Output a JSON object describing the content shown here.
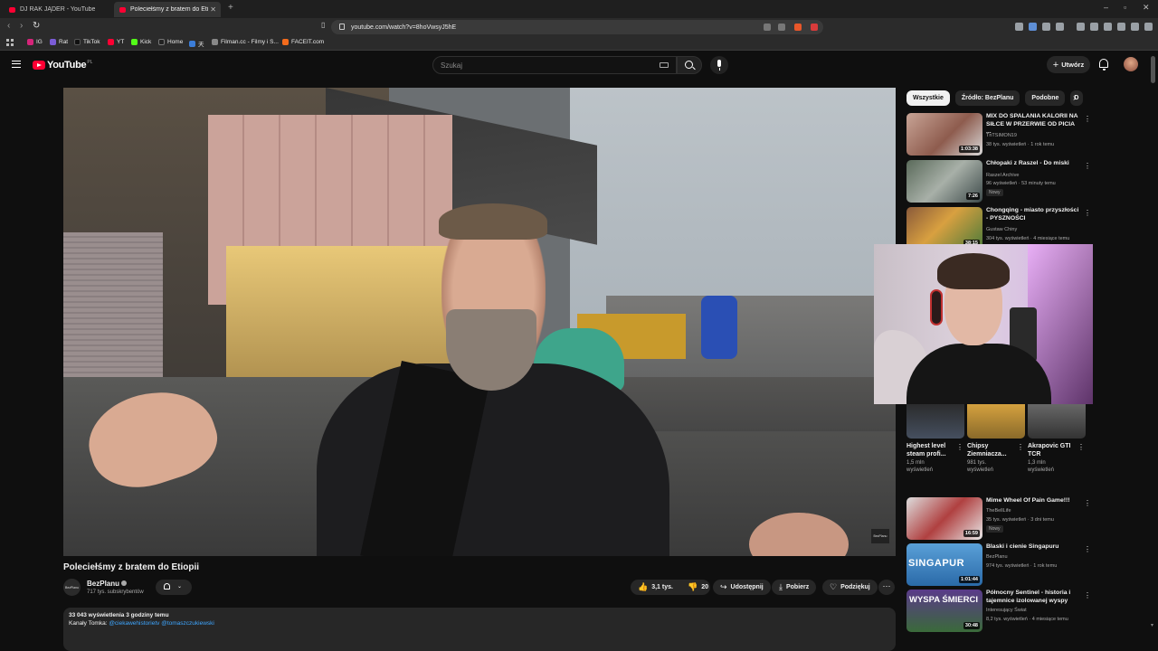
{
  "browser": {
    "tabs": [
      {
        "title": "DJ RAK JĄDER - YouTube"
      },
      {
        "title": "Poleciełśmy z bratem do Etiopii"
      }
    ],
    "address": "youtube.com/watch?v=8hoVwsyJ5hE",
    "bookmarks": [
      "IG",
      "Rat",
      "TikTok",
      "YT",
      "Kick",
      "Home",
      "天",
      "Filman.cc - Filmy i S...",
      "FACEIT.com"
    ]
  },
  "header": {
    "logo_text": "YouTube",
    "country_code": "PL",
    "search_placeholder": "Szukaj",
    "create_label": "Utwórz"
  },
  "video": {
    "title": "Poleciełśmy z bratem do Etiopii",
    "channel": "BezPlanu",
    "channel_avatar_text": "BezPlanu",
    "subscribers": "717 tys. subskrybentów",
    "watermark": "BezPlanu",
    "likes": "3,1 tys.",
    "dislikes": "20",
    "share_label": "Udostępnij",
    "download_label": "Pobierz",
    "thanks_label": "Podziękuj",
    "more": "⋯",
    "description": {
      "meta": "33 043 wyświetlenia  3 godziny temu",
      "links_prefix": "Kanały Tomka: ",
      "link1": "@ciekawehistorietv",
      "link2": "@tomaszczukiewski"
    }
  },
  "sidebar": {
    "chips": [
      "Wszystkie",
      "Źródło: BezPlanu",
      "Podobne",
      "D"
    ],
    "recommendations": [
      {
        "title": "MIX DO SPALANIA KALORII NA SIŁCE W PRZERWIE OD PICIA ...",
        "channel": "TnTSIMON19",
        "views": "38 tys. wyświetleń · 1 rok temu",
        "duration": "1:03:38",
        "badge": ""
      },
      {
        "title": "Chłopaki z Raszel - Do miski",
        "channel": "Raszel Archive",
        "views": "96 wyświetleń · 53 minuty temu",
        "duration": "7:26",
        "badge": "Nowy"
      },
      {
        "title": "Chongqing - miasto przyszłości - PYSZNOŚCI",
        "channel": "Gustaw Chiny",
        "views": "304 tys. wyświetleń · 4 miesiące temu",
        "duration": "38:15",
        "badge": ""
      },
      {
        "title": "Mime Wheel Of Pain Game!!!",
        "channel": "TheBellLife",
        "views": "35 tys. wyświetleń · 3 dni temu",
        "duration": "16:59",
        "badge": "Nowy"
      },
      {
        "title": "Blaski i cienie Singapuru",
        "channel": "BezPlanu",
        "views": "974 tys. wyświetleń · 1 rok temu",
        "duration": "1:01:44",
        "badge": "",
        "thumb_text": "SINGAPUR"
      },
      {
        "title": "Północny Sentinel - historia i tajemnice izolowanej wyspy",
        "channel": "Interesujący Świat",
        "views": "8,2 tys. wyświetleń · 4 miesiące temu",
        "duration": "30:48",
        "badge": "",
        "thumb_text": "WYSPA ŚMIERCI"
      }
    ],
    "shorts": [
      {
        "title": "Highest level steam profi...",
        "views_line1": "1,5 mln",
        "views_line2": "wyświetleń"
      },
      {
        "title": "Chipsy Ziemniacza...",
        "views_line1": "981 tys.",
        "views_line2": "wyświetleń"
      },
      {
        "title": "Akrapovic GTI TCR",
        "views_line1": "1,3 mln",
        "views_line2": "wyświetleń"
      }
    ]
  },
  "icons": {
    "kebab": "⋮",
    "chevron_right": "›",
    "like": "👍",
    "dislike": "👎",
    "share": "↪",
    "download": "⤓",
    "thanks": "♡"
  }
}
